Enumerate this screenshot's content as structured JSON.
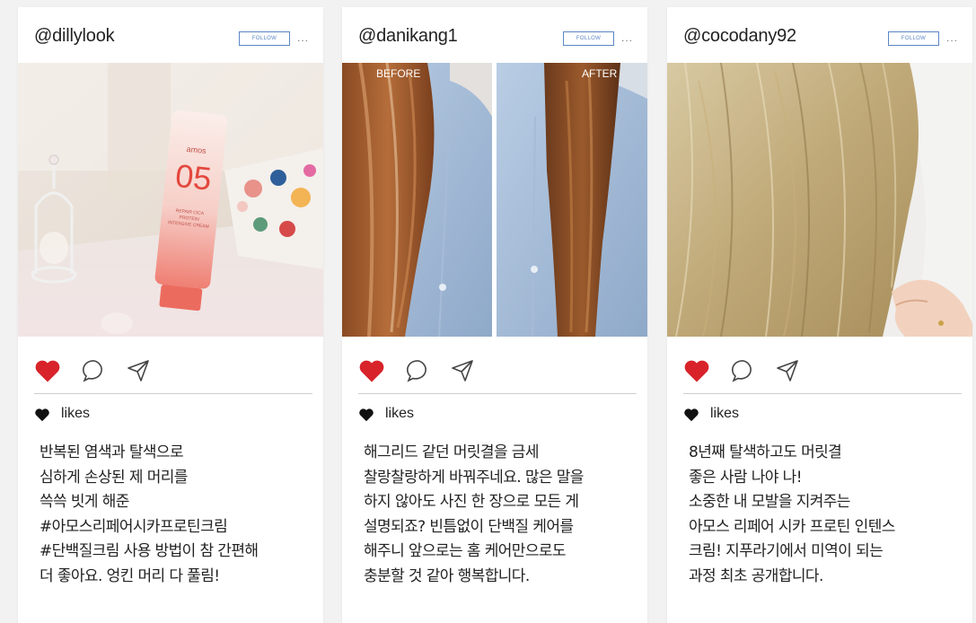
{
  "colors": {
    "heart": "#d8232a",
    "follow_border": "#5a86c4",
    "divider": "#cfcfcf"
  },
  "posts": [
    {
      "username": "@dillylook",
      "follow_label": "FOLLOW",
      "more_label": "...",
      "likes_label": "likes",
      "liked": true,
      "caption": "반복된 염색과 탈색으로\n심하게 손상된 제 머리를\n쓱쓱 빗게 해준\n#아모스리페어시카프로틴크림\n#단백질크림 사용 방법이 참 간편해\n더 좋아요. 엉킨 머리 다 풀림!",
      "photo": {
        "brand": "amos",
        "number": "05",
        "product_line1": "REPAIR CICA",
        "product_line2": "PROTEIN",
        "product_line3": "INTENSIVE CREAM"
      }
    },
    {
      "username": "@danikang1",
      "follow_label": "FOLLOW",
      "more_label": "...",
      "likes_label": "likes",
      "liked": true,
      "caption": "해그리드 같던 머릿결을 금세\n찰랑찰랑하게 바꿔주네요. 많은 말을\n하지 않아도 사진 한 장으로 모든 게\n설명되죠? 빈틈없이 단백질 케어를\n해주니 앞으로는 홈 케어만으로도\n충분할 것 같아 행복합니다.",
      "photo": {
        "before_label": "BEFORE",
        "after_label": "AFTER"
      }
    },
    {
      "username": "@cocodany92",
      "follow_label": "FOLLOW",
      "more_label": "...",
      "likes_label": "likes",
      "liked": true,
      "caption": "8년째 탈색하고도 머릿결\n좋은 사람 나야 나!\n소중한 내 모발을 지켜주는\n아모스 리페어 시카 프로틴 인텐스\n크림! 지푸라기에서 미역이 되는\n과정 최초 공개합니다."
    }
  ]
}
